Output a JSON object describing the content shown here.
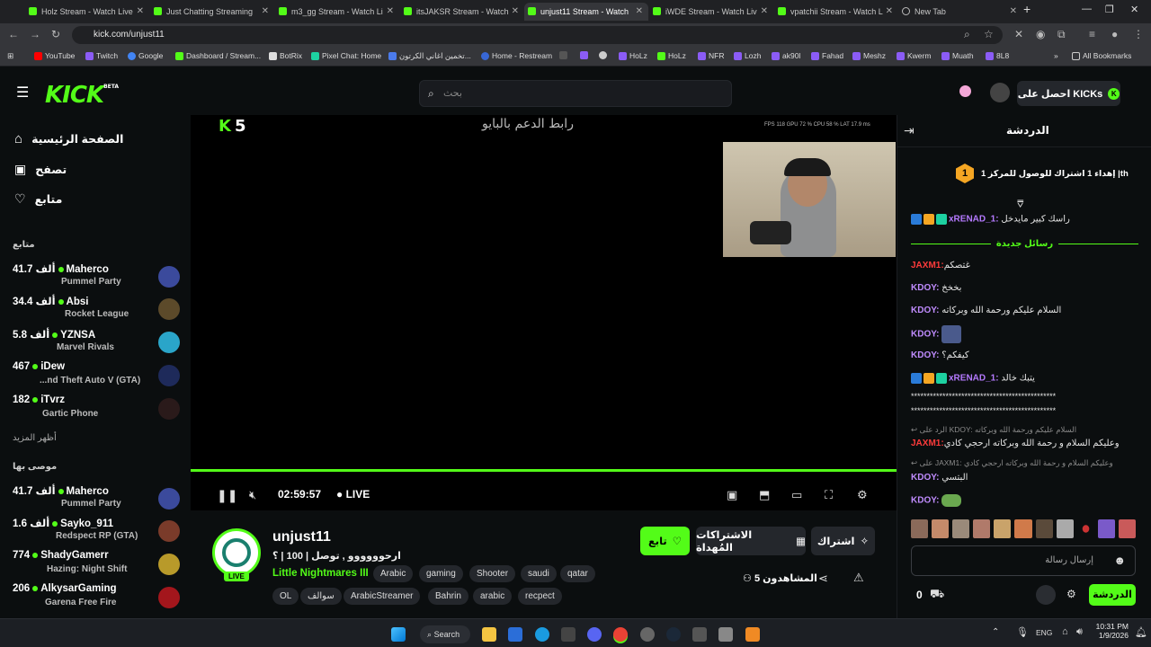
{
  "browser": {
    "tabs": [
      {
        "title": "Holz Stream - Watch Live",
        "active": false
      },
      {
        "title": "Just Chatting Streaming",
        "active": false
      },
      {
        "title": "m3_gg Stream - Watch Li",
        "active": false
      },
      {
        "title": "itsJAKSR Stream - Watch",
        "active": false
      },
      {
        "title": "unjust11 Stream - Watch",
        "active": true
      },
      {
        "title": "iWDE Stream - Watch Liv",
        "active": false
      },
      {
        "title": "vpatchii Stream - Watch L",
        "active": false
      },
      {
        "title": "New Tab",
        "active": false
      }
    ],
    "url": "kick.com/unjust11",
    "bookmarks": [
      "YouTube",
      "Twitch",
      "Google",
      "Dashboard / Stream...",
      "BotRix",
      "Pixel Chat: Home",
      "تخمين اغاني الكرتون...",
      "Home - Restream",
      "HoLz",
      "HoLz",
      "NFR",
      "Lozh",
      "ak90l",
      "Fahad",
      "Meshz",
      "Kwerm",
      "Muath",
      "8L8"
    ],
    "all_bookmarks": "All Bookmarks"
  },
  "header": {
    "logo": "KICK",
    "logo_beta": "BETA",
    "search_placeholder": "بحث",
    "kicks_button": "احصل على KICKs"
  },
  "sidebar": {
    "nav": [
      {
        "label": "الصفحة الرئيسية",
        "icon": "home-icon"
      },
      {
        "label": "تصفح",
        "icon": "browse-icon"
      },
      {
        "label": "متابع",
        "icon": "heart-icon"
      }
    ],
    "following_title": "متابع",
    "following": [
      {
        "viewers": "41.7 ألف",
        "name": "Maherco",
        "game": "Pummel Party"
      },
      {
        "viewers": "34.4 ألف",
        "name": "Absi",
        "game": "Rocket League"
      },
      {
        "viewers": "5.8 ألف",
        "name": "YZNSA",
        "game": "Marvel Rivals"
      },
      {
        "viewers": "467",
        "name": "iDew",
        "game": "...nd Theft Auto V (GTA)"
      },
      {
        "viewers": "182",
        "name": "iTvrz",
        "game": "Gartic Phone"
      }
    ],
    "show_more": "أظهر المزيد",
    "recommended_title": "موصى بها",
    "recommended": [
      {
        "viewers": "41.7 ألف",
        "name": "Maherco",
        "game": "Pummel Party"
      },
      {
        "viewers": "1.6 ألف",
        "name": "Sayko_911",
        "game": "Redspect RP (GTA)"
      },
      {
        "viewers": "774",
        "name": "ShadyGamerr",
        "game": "Hazing: Night Shift"
      },
      {
        "viewers": "206",
        "name": "AlkysarGaming",
        "game": "Garena Free Fire"
      }
    ]
  },
  "player": {
    "overlay_text": "رابط الدعم بالبايو",
    "k5_k": "K",
    "k5_num": "5",
    "stats": "FPS 118   GPU 72 %   CPU 58 %   LAT 17.9 ms",
    "time": "02:59:57",
    "live_label": "LIVE",
    "progress": 1.0
  },
  "stream": {
    "channel": "unjust11",
    "live_badge": "LIVE",
    "title": "ارحوووووو , توصل | 100 | ؟",
    "game": "Little Nightmares III",
    "tags_row1": [
      "Arabic",
      "gaming",
      "Shooter",
      "saudi",
      "qatar"
    ],
    "tags_row2": [
      "OL",
      "سوالف",
      "ArabicStreamer",
      "Bahrin",
      "arabic",
      "recpect"
    ],
    "follow_button": "تابع",
    "gift_button": "الاشتراكات المُهداة",
    "subscribe_button": "اشتراك",
    "viewers": "5 المشاهدون"
  },
  "chat": {
    "title": "الدردشة",
    "gift_goal": "إهداء 1 اشتراك للوصول للمركز 1 |th",
    "gift_rank": "1",
    "new_messages": "رسائل جديدة",
    "messages": [
      {
        "user": "xRENAD_1",
        "text": "راسك كبير مايدخل",
        "color": "#b57aff",
        "badges": true
      },
      {
        "user": "JAXM1",
        "text": "غتصكم",
        "color": "#ff3b3b",
        "badges": false
      },
      {
        "user": "KDOY",
        "text": "بخخخ",
        "color": "#c08cff",
        "badges": false
      },
      {
        "user": "KDOY",
        "text": "السلام عليكم ورحمة الله وبركاته",
        "color": "#c08cff",
        "badges": false
      },
      {
        "user": "KDOY",
        "text": "",
        "color": "#c08cff",
        "badges": false
      },
      {
        "user": "KDOY",
        "text": "كيفكم؟",
        "color": "#c08cff",
        "badges": false
      },
      {
        "user": "xRENAD_1",
        "text": "يتبك خالد",
        "color": "#b57aff",
        "badges": true
      },
      {
        "user": "",
        "text": "**********************************************",
        "color": "#e6e6e6",
        "badges": false
      },
      {
        "user": "",
        "text": "**********************************************",
        "color": "#e6e6e6",
        "badges": false
      },
      {
        "user": "JAXM1",
        "text": "وعليكم السلام و رحمة الله وبركاته ارحجي كادي",
        "color": "#ff3b3b",
        "badges": false,
        "reply": "الرد على KDOY: السلام عليكم ورحمة الله وبركاته"
      },
      {
        "user": "KDOY",
        "text": "البتسي",
        "color": "#c08cff",
        "badges": false,
        "reply": "على JAXM1: وعليكم السلام و رحمة الله وبركاته ارحجي كادي"
      },
      {
        "user": "KDOY",
        "text": "",
        "color": "#c08cff",
        "badges": false
      }
    ],
    "input_placeholder": "إرسال رسالة",
    "points": "0",
    "send_button": "الدردشة"
  },
  "taskbar": {
    "search": "Search",
    "lang": "ENG",
    "time": "10:31 PM",
    "date": "1/9/2026"
  }
}
